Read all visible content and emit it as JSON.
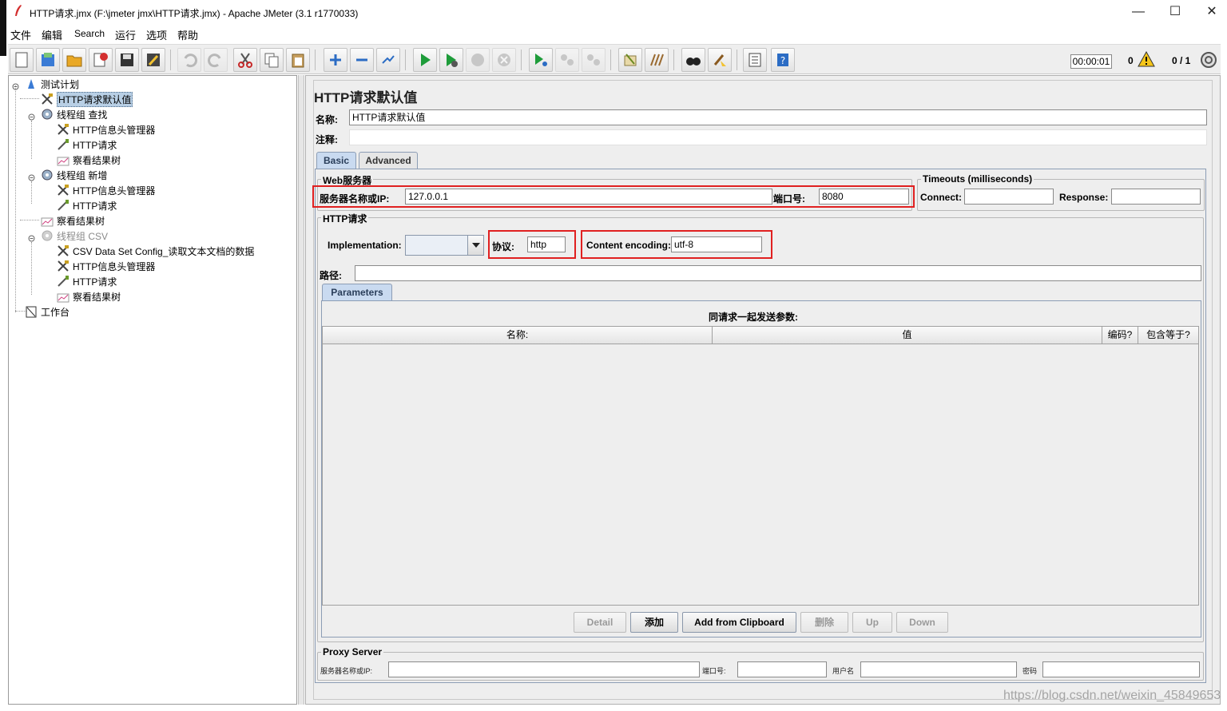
{
  "window": {
    "title": "HTTP请求.jmx (F:\\jmeter jmx\\HTTP请求.jmx) - Apache JMeter (3.1 r1770033)",
    "minimize": "—",
    "maximize": "☐",
    "close": "✕"
  },
  "menu": [
    "文件",
    "编辑",
    "Search",
    "运行",
    "选项",
    "帮助"
  ],
  "status": {
    "timer": "00:00:01",
    "errors": "0",
    "threads": "0 / 1"
  },
  "tree": {
    "root": "测试计划",
    "defaults": "HTTP请求默认值",
    "group1": "线程组 查找",
    "group1_header": "HTTP信息头管理器",
    "group1_request": "HTTP请求",
    "group1_results": "察看结果树",
    "group2": "线程组 新增",
    "group2_header": "HTTP信息头管理器",
    "group2_request": "HTTP请求",
    "results": "察看结果树",
    "group3": "线程组  CSV",
    "group3_csv": "CSV Data Set Config_读取文本文档的数据",
    "group3_header": "HTTP信息头管理器",
    "group3_request": "HTTP请求",
    "group3_results": "察看结果树",
    "workbench": "工作台"
  },
  "panel": {
    "title": "HTTP请求默认值",
    "name_label": "名称:",
    "name_value": "HTTP请求默认值",
    "comment_label": "注释:",
    "comment_value": "",
    "tabs": {
      "basic": "Basic",
      "advanced": "Advanced"
    },
    "web_server": {
      "group_title": "Web服务器",
      "server_label": "服务器名称或IP:",
      "server_value": "127.0.0.1",
      "port_label": "端口号:",
      "port_value": "8080"
    },
    "timeouts": {
      "group_title": "Timeouts (milliseconds)",
      "connect_label": "Connect:",
      "connect_value": "",
      "response_label": "Response:",
      "response_value": ""
    },
    "http_request": {
      "group_title": "HTTP请求",
      "implementation_label": "Implementation:",
      "implementation_value": "",
      "protocol_label": "协议:",
      "protocol_value": "http",
      "encoding_label": "Content encoding:",
      "encoding_value": "utf-8",
      "path_label": "路径:",
      "path_value": ""
    },
    "parameters": {
      "tab": "Parameters",
      "caption": "同请求一起发送参数:",
      "columns": [
        "名称:",
        "值",
        "编码?",
        "包含等于?"
      ],
      "buttons": {
        "detail": "Detail",
        "add": "添加",
        "add_clipboard": "Add from Clipboard",
        "delete": "删除",
        "up": "Up",
        "down": "Down"
      }
    },
    "proxy": {
      "group_title": "Proxy Server",
      "server_label": "服务器名称或IP:",
      "port_label": "端口号:",
      "user_label": "用户名",
      "password_label": "密码"
    }
  },
  "watermark": "https://blog.csdn.net/weixin_45849653",
  "colors": {
    "highlight_red": "#e02020",
    "selection": "#b8cfe5",
    "tab_active": "#c9daf0",
    "panel_bg": "#eeeeee"
  }
}
